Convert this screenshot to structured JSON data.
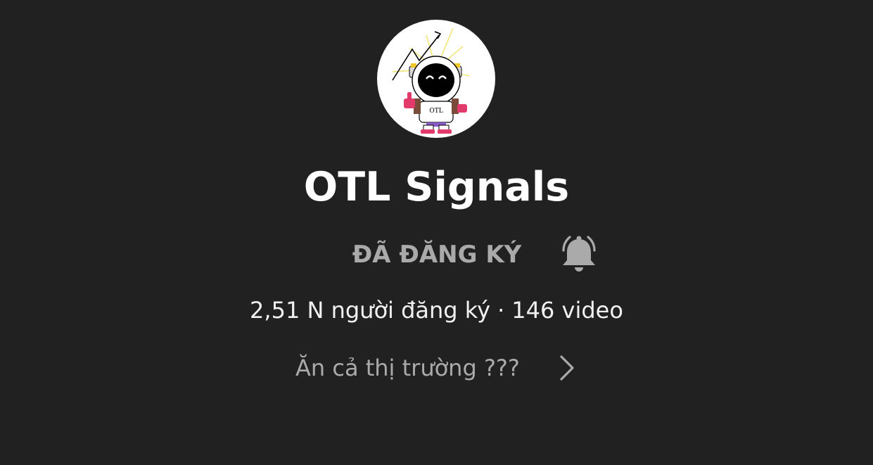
{
  "channel": {
    "name": "OTL Signals",
    "avatar_icon": "astronaut-avatar",
    "avatar_text": "OTL"
  },
  "subscription": {
    "label": "ĐÃ ĐĂNG KÝ",
    "bell_icon": "bell-icon"
  },
  "stats": {
    "subscribers": "2,51 N người đăng ký",
    "separator": "·",
    "videos": "146 video"
  },
  "description": {
    "text": "Ăn cả thị trường ???",
    "chevron_icon": "chevron-right-icon"
  },
  "colors": {
    "background": "#212121",
    "title": "#ffffff",
    "muted": "#aaaaaa",
    "stats": "#f1f1f1"
  }
}
